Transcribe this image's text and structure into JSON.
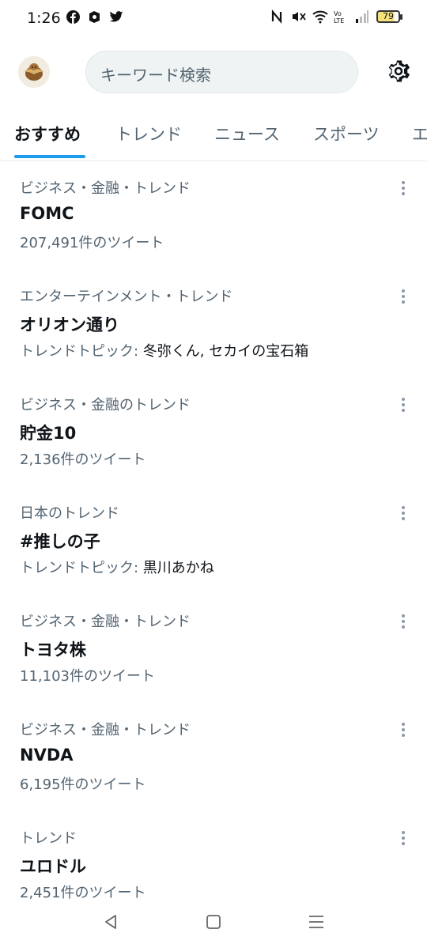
{
  "status_bar": {
    "time": "1:26",
    "battery": "79"
  },
  "header": {
    "search_placeholder": "キーワード検索"
  },
  "tabs": [
    {
      "label": "おすすめ"
    },
    {
      "label": "トレンド"
    },
    {
      "label": "ニュース"
    },
    {
      "label": "スポーツ"
    },
    {
      "label": "エ"
    }
  ],
  "trends": [
    {
      "category": "ビジネス・金融・トレンド",
      "name": "FOMC",
      "meta": "207,491件のツイート"
    },
    {
      "category": "エンターテインメント・トレンド",
      "name": "オリオン通り",
      "meta_prefix": "トレンドトピック: ",
      "meta_topics": "冬弥くん, セカイの宝石箱"
    },
    {
      "category": "ビジネス・金融のトレンド",
      "name": "貯金10",
      "meta": "2,136件のツイート"
    },
    {
      "category": "日本のトレンド",
      "name": "#推しの子",
      "meta_prefix": "トレンドトピック: ",
      "meta_topics": "黒川あかね"
    },
    {
      "category": "ビジネス・金融・トレンド",
      "name": "トヨタ株",
      "meta": "11,103件のツイート"
    },
    {
      "category": "ビジネス・金融・トレンド",
      "name": "NVDA",
      "meta": "6,195件のツイート"
    },
    {
      "category": "トレンド",
      "name": "ユロドル",
      "meta": "2,451件のツイート"
    }
  ],
  "colors": {
    "accent": "#1d9bf0",
    "secondary_text": "#536471",
    "primary_text": "#0f1419"
  }
}
